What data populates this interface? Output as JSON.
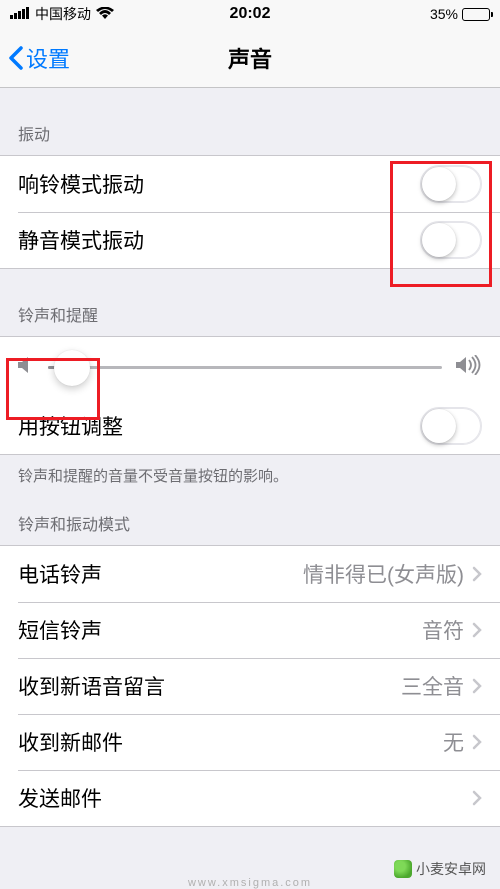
{
  "status": {
    "carrier": "中国移动",
    "time": "20:02",
    "battery_pct": "35%"
  },
  "nav": {
    "back_label": "设置",
    "title": "声音"
  },
  "sections": {
    "vibration": {
      "header": "振动",
      "ring_vibrate": "响铃模式振动",
      "silent_vibrate": "静音模式振动"
    },
    "ringer": {
      "header": "铃声和提醒",
      "change_with_buttons": "用按钮调整",
      "footer": "铃声和提醒的音量不受音量按钮的影响。"
    },
    "patterns": {
      "header": "铃声和振动模式",
      "ringtone": {
        "label": "电话铃声",
        "value": "情非得已(女声版)"
      },
      "text_tone": {
        "label": "短信铃声",
        "value": "音符"
      },
      "new_voicemail": {
        "label": "收到新语音留言",
        "value": "三全音"
      },
      "new_mail": {
        "label": "收到新邮件",
        "value": "无"
      },
      "sent_mail": {
        "label": "发送邮件",
        "value": ""
      }
    }
  },
  "watermark": {
    "text": "小麦安卓网",
    "url": "www.xmsigma.com"
  }
}
